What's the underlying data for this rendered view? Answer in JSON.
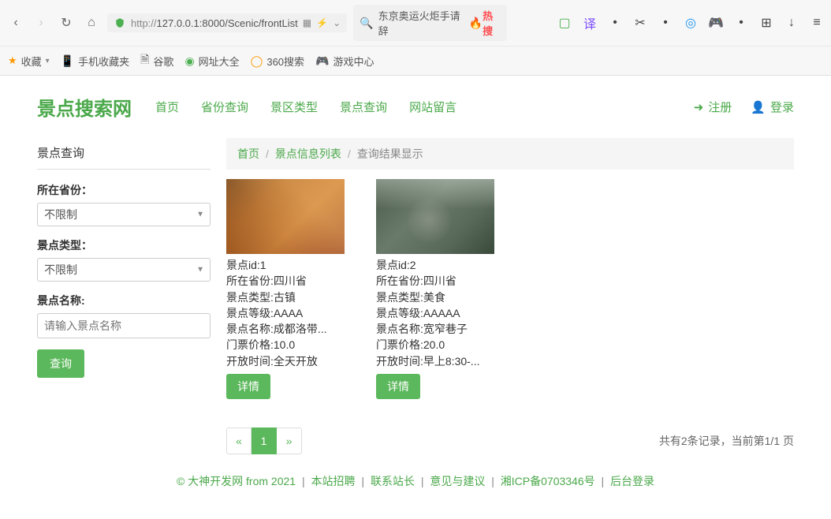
{
  "browser": {
    "url_proto": "http://",
    "url_path": "127.0.0.1:8000/Scenic/frontList",
    "search_placeholder": "东京奥运火炬手请辞",
    "hot_label": "热搜"
  },
  "bookmarks": {
    "favorites": "收藏",
    "mobile": "手机收藏夹",
    "google": "谷歌",
    "url_all": "网址大全",
    "search360": "360搜索",
    "game_center": "游戏中心"
  },
  "site": {
    "logo": "景点搜索网",
    "nav": {
      "home": "首页",
      "province": "省份查询",
      "area_type": "景区类型",
      "scenic_search": "景点查询",
      "message": "网站留言"
    },
    "auth": {
      "register": "注册",
      "login": "登录"
    }
  },
  "sidebar": {
    "title": "景点查询",
    "province_label": "所在省份：",
    "province_value": "不限制",
    "type_label": "景点类型：",
    "type_value": "不限制",
    "name_label": "景点名称:",
    "name_placeholder": "请输入景点名称",
    "submit": "查询"
  },
  "breadcrumb": {
    "home": "首页",
    "list": "景点信息列表",
    "current": "查询结果显示"
  },
  "results": [
    {
      "id_label": "景点id:1",
      "province": "所在省份:四川省",
      "type": "景点类型:古镇",
      "grade": "景点等级:AAAA",
      "name": "景点名称:成都洛带...",
      "price": "门票价格:10.0",
      "open_time": "开放时间:全天开放",
      "detail_btn": "详情"
    },
    {
      "id_label": "景点id:2",
      "province": "所在省份:四川省",
      "type": "景点类型:美食",
      "grade": "景点等级:AAAAA",
      "name": "景点名称:宽窄巷子",
      "price": "门票价格:20.0",
      "open_time": "开放时间:早上8:30-...",
      "detail_btn": "详情"
    }
  ],
  "pagination": {
    "prev": "«",
    "page1": "1",
    "next": "»",
    "info": "共有2条记录，当前第1/1 页"
  },
  "footer": {
    "copyright": "© 大神开发网 from 2021",
    "recruit": "本站招聘",
    "contact": "联系站长",
    "feedback": "意见与建议",
    "icp": "湘ICP备0703346号",
    "admin": "后台登录"
  }
}
